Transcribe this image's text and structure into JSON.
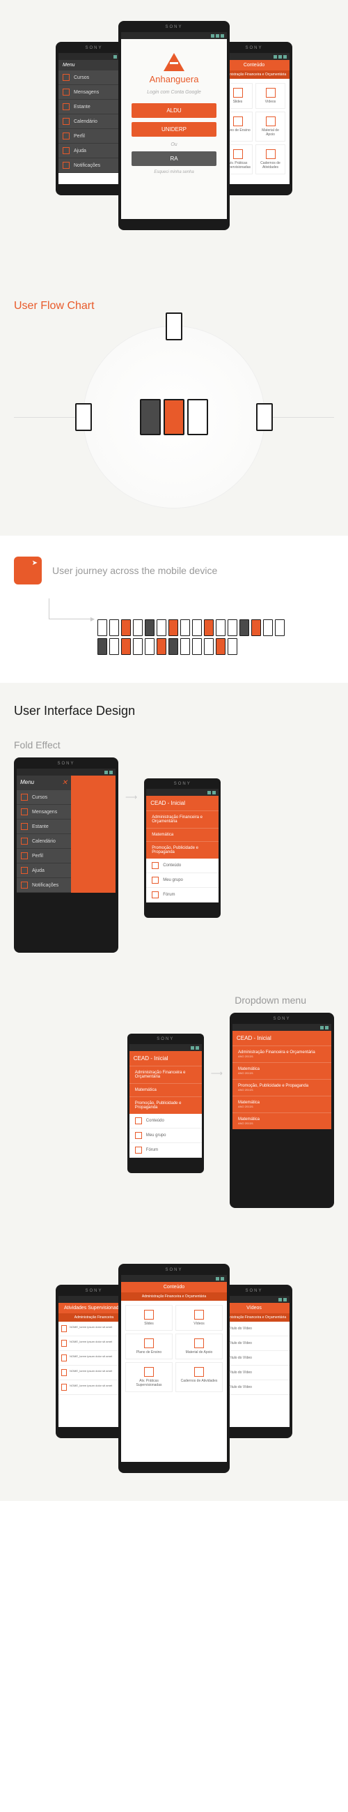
{
  "phone_brand": "SONY",
  "app_brand": "Anhanguera",
  "login": {
    "subtitle": "Login com Conta Google",
    "btn1": "ALDU",
    "btn2": "UNIDERP",
    "or": "Ou",
    "btn3": "RA",
    "forgot": "Esqueci minha senha"
  },
  "menu": {
    "title": "Menu",
    "items": [
      "Cursos",
      "Mensagens",
      "Estante",
      "Calendário",
      "Perfil",
      "Ajuda",
      "Notificações"
    ]
  },
  "content": {
    "title": "Conteúdo",
    "subtitle": "Administração Financeira e Orçamentária",
    "tiles": [
      "Slides",
      "Vídeos",
      "Plano de Ensino",
      "Material de Apoio",
      "Atv. Práticas Supervisionadas",
      "Cadernos de Atividades"
    ]
  },
  "sections": {
    "flow": "User Flow Chart",
    "journey": "User journey across the mobile device",
    "ui": "User Interface Design",
    "fold": "Fold Effect",
    "dropdown": "Dropdown menu"
  },
  "dropdown": {
    "header": "CEAD - Inicial",
    "items": [
      {
        "title": "Administração Financeira e Orçamentária",
        "sub": "ANO 2013/1"
      },
      {
        "title": "Matemática",
        "sub": "ANO 2013/1"
      },
      {
        "title": "Promoção, Publicidade e Propaganda",
        "sub": "ANO 2013/1"
      },
      {
        "title": "Matemática",
        "sub": "ANO 2013/1"
      },
      {
        "title": "Matemática",
        "sub": "ANO 2013/1"
      }
    ],
    "white_items": [
      "Conteúdo",
      "Meu grupo",
      "Fórum"
    ]
  },
  "bottom": {
    "left_header": "Atividades Supervisionadas",
    "left_sub": "Administração Financeira",
    "right_header": "Vídeos",
    "video_title": "Título do Vídeo"
  }
}
